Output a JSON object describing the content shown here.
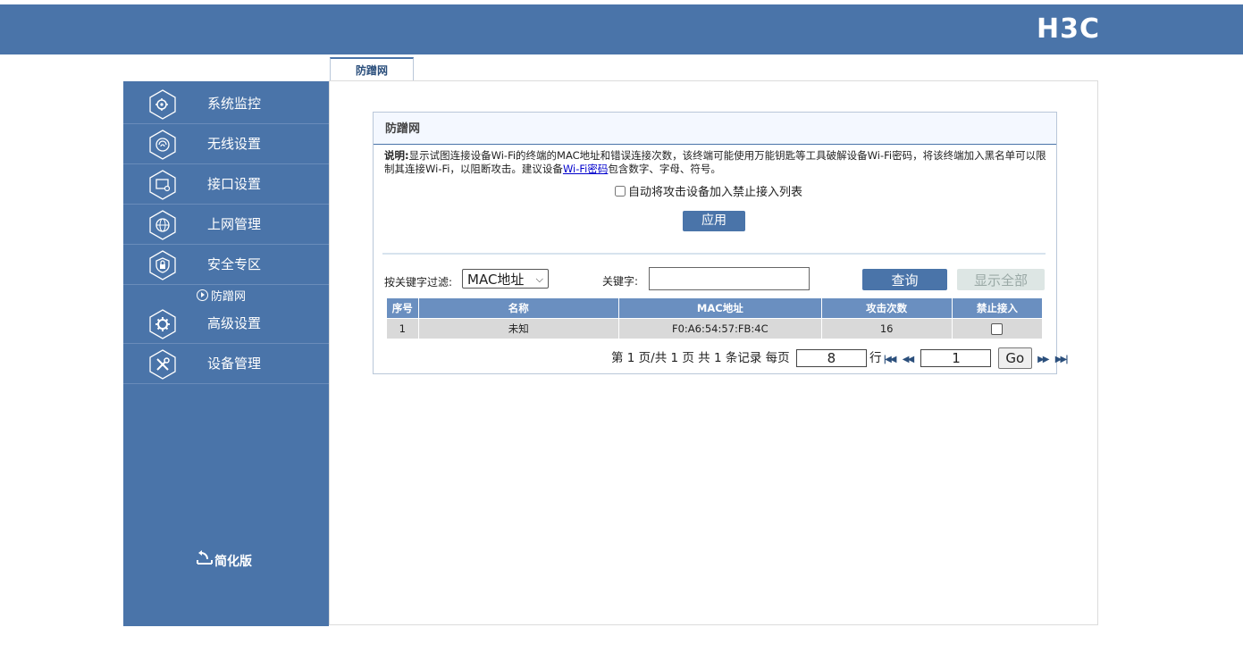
{
  "brand": {
    "logo": "H3C",
    "color": "#4a74a9"
  },
  "tab": {
    "label": "防蹭网"
  },
  "sidebar": {
    "items": [
      {
        "label": "系统监控",
        "icon": "monitor-gear-icon"
      },
      {
        "label": "无线设置",
        "icon": "wifi-icon"
      },
      {
        "label": "接口设置",
        "icon": "interface-icon"
      },
      {
        "label": "上网管理",
        "icon": "globe-icon"
      },
      {
        "label": "安全专区",
        "icon": "shield-lock-icon"
      },
      {
        "label": "高级设置",
        "icon": "gear-icon"
      },
      {
        "label": "设备管理",
        "icon": "tools-icon"
      }
    ],
    "sub_item": "防蹭网",
    "simple_mode": "简化版"
  },
  "panel": {
    "title": "防蹭网",
    "desc_label": "说明:",
    "desc_text_1": "显示试图连接设备Wi-Fi的终端的MAC地址和错误连接次数，该终端可能使用万能钥匙等工具破解设备Wi-Fi密码，将该终端加入黑名单可以限制其连接Wi-Fi，以阻断攻击。建议设备",
    "desc_link": "Wi-Fi密码",
    "desc_text_2": "包含数字、字母、符号。",
    "auto_checkbox_label": "自动将攻击设备加入禁止接入列表",
    "apply_button": "应用",
    "filter_label": "按关键字过滤:",
    "filter_selected": "MAC地址",
    "keyword_label": "关键字:",
    "keyword_value": "",
    "query_button": "查询",
    "show_all_button": "显示全部"
  },
  "table": {
    "columns": [
      "序号",
      "名称",
      "MAC地址",
      "攻击次数",
      "禁止接入"
    ],
    "rows": [
      {
        "index": "1",
        "name": "未知",
        "mac": "F0:A6:54:57:FB:4C",
        "attacks": "16"
      }
    ]
  },
  "pager": {
    "summary": "第 1 页/共 1 页 共 1 条记录 每页",
    "per_page": "8",
    "rows_unit": "行",
    "page_input": "1",
    "go_button": "Go"
  }
}
